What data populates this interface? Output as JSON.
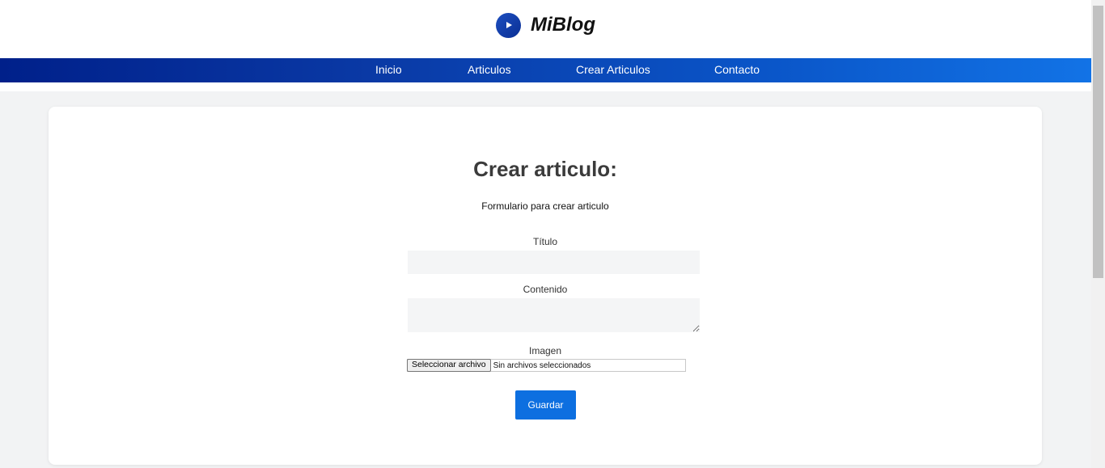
{
  "header": {
    "brand_name": "MiBlog",
    "logo_icon": "play-circle-icon"
  },
  "nav": {
    "items": [
      {
        "label": "Inicio"
      },
      {
        "label": "Articulos"
      },
      {
        "label": "Crear Articulos"
      },
      {
        "label": "Contacto"
      }
    ]
  },
  "form": {
    "title": "Crear articulo:",
    "subtitle": "Formulario para crear articulo",
    "title_label": "Título",
    "title_value": "",
    "content_label": "Contenido",
    "content_value": "",
    "image_label": "Imagen",
    "file_button_label": "Seleccionar archivo",
    "file_status": "Sin archivos seleccionados",
    "save_label": "Guardar"
  },
  "colors": {
    "accent": "#0d6fe0",
    "nav_start": "#00208a",
    "nav_end": "#1273e6"
  }
}
